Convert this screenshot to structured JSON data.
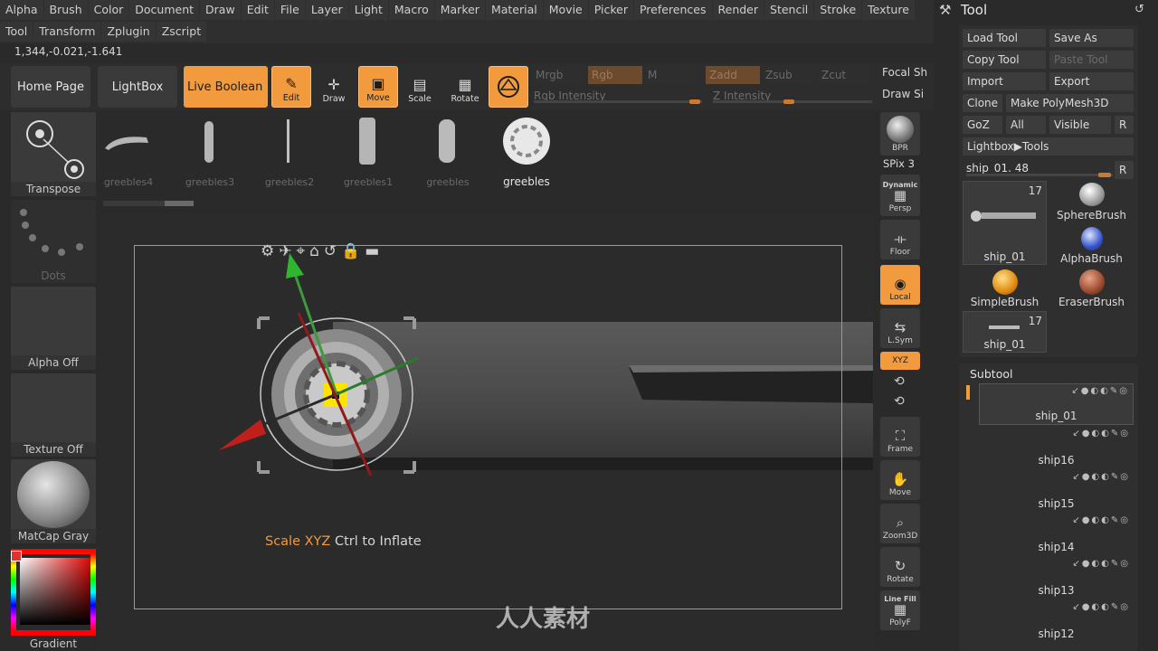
{
  "menu": [
    "Alpha",
    "Brush",
    "Color",
    "Document",
    "Draw",
    "Edit",
    "File",
    "Layer",
    "Light",
    "Macro",
    "Marker",
    "Material",
    "Movie",
    "Picker",
    "Preferences",
    "Render",
    "Stencil",
    "Stroke",
    "Texture"
  ],
  "menu2": [
    "Tool",
    "Transform",
    "Zplugin",
    "Zscript"
  ],
  "coords": "1,344,-0.021,-1.641",
  "shelf": {
    "home": "Home Page",
    "lightbox": "LightBox",
    "live_boolean": "Live Boolean",
    "edit": "Edit",
    "draw": "Draw",
    "move": "Move",
    "scale": "Scale",
    "rotate": "Rotate",
    "mrgb": "Mrgb",
    "rgb": "Rgb",
    "m": "M",
    "zadd": "Zadd",
    "zsub": "Zsub",
    "zcut": "Zcut",
    "rgb_intensity": "Rgb Intensity",
    "z_intensity": "Z Intensity",
    "focal": "Focal Sh",
    "drawsize": "Draw Si"
  },
  "left": {
    "transpose": "Transpose",
    "dots": "Dots",
    "alpha": "Alpha Off",
    "texture": "Texture Off",
    "matcap": "MatCap Gray",
    "gradient": "Gradient"
  },
  "thumbs": [
    "greebles4",
    "greebles3",
    "greebles2",
    "greebles1",
    "greebles",
    "greebles"
  ],
  "viewport": {
    "hint_key": "Scale XYZ",
    "hint_rest": " Ctrl to Inflate"
  },
  "rightcol": {
    "bpr": "BPR",
    "spix": "SPix 3",
    "dynamic": "Dynamic",
    "persp": "Persp",
    "floor": "Floor",
    "local": "Local",
    "lsym": "L.Sym",
    "xyz": "XYZ",
    "frame": "Frame",
    "move": "Move",
    "zoom": "Zoom3D",
    "rotate": "Rotate",
    "linefill": "Line Fill",
    "polyf": "PolyF"
  },
  "tool": {
    "title": "Tool",
    "load": "Load Tool",
    "saveas": "Save As",
    "copy": "Copy Tool",
    "paste": "Paste Tool",
    "import": "Import",
    "export": "Export",
    "clone": "Clone",
    "make": "Make PolyMesh3D",
    "goz": "GoZ",
    "all": "All",
    "visible": "Visible",
    "r": "R",
    "lightbox_tools": "Lightbox▶Tools",
    "ship_slider": "ship_01. 48",
    "tiles": [
      {
        "name": "ship_01",
        "count": "17"
      },
      {
        "name": "SphereBrush",
        "count": ""
      },
      {
        "name": "AlphaBrush",
        "count": ""
      },
      {
        "name": "SimpleBrush",
        "count": ""
      },
      {
        "name": "EraserBrush",
        "count": ""
      },
      {
        "name": "ship_01",
        "count": "17"
      }
    ]
  },
  "subtool": {
    "title": "Subtool",
    "items": [
      "ship_01",
      "ship16",
      "ship15",
      "ship14",
      "ship13",
      "ship12"
    ]
  },
  "watermark": "人人素材",
  "colors": {
    "accent": "#f19a3e",
    "bg": "#2a2a2a"
  }
}
